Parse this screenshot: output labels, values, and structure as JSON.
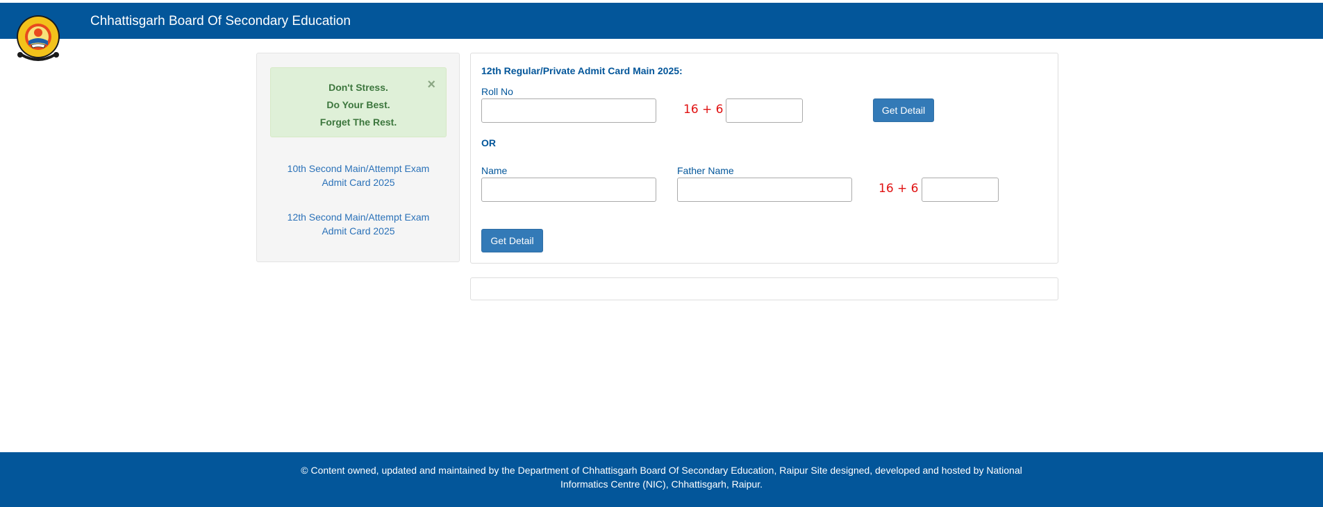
{
  "header": {
    "title": "Chhattisgarh Board Of Secondary Education"
  },
  "alert": {
    "lines": [
      "Don't Stress.",
      "Do Your Best.",
      "Forget The Rest."
    ],
    "close_symbol": "×"
  },
  "sidebar": {
    "links": [
      {
        "label": "10th Second Main/Attempt Exam Admit Card 2025"
      },
      {
        "label": "12th Second Main/Attempt Exam Admit Card 2025"
      }
    ]
  },
  "form": {
    "title": "12th Regular/Private Admit Card Main 2025:",
    "roll_label": "Roll No",
    "roll_value": "",
    "captcha1_text": "16 + 6 =",
    "captcha1_value": "",
    "get_detail_1": "Get Detail",
    "or_label": "OR",
    "name_label": "Name",
    "name_value": "",
    "father_label": "Father Name",
    "father_value": "",
    "captcha2_text": "16 + 6 =",
    "captcha2_value": "",
    "get_detail_2": "Get Detail"
  },
  "footer": {
    "text": "© Content owned, updated and maintained by the Department of Chhattisgarh Board Of Secondary Education, Raipur Site designed, developed and hosted by National Informatics Centre (NIC), Chhattisgarh, Raipur."
  },
  "colors": {
    "header_bg": "#03569a",
    "accent_text": "#03569a",
    "button_bg": "#337ab7",
    "captcha_red": "#e01010",
    "alert_bg": "#dff0d8",
    "alert_text": "#3c763d"
  },
  "icons": {
    "logo": "board-emblem-icon",
    "close": "close-icon"
  }
}
